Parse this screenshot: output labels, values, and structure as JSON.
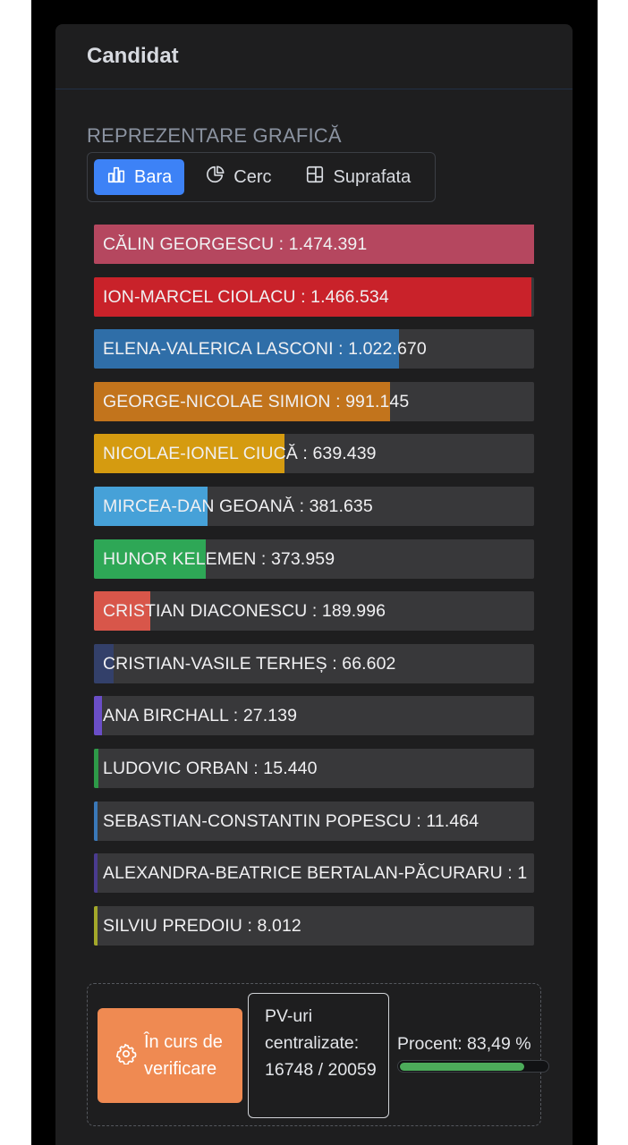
{
  "header": {
    "title": "Candidat"
  },
  "chart_section": {
    "label": "REPREZENTARE GRAFICĂ"
  },
  "view_toggle": {
    "options": [
      {
        "label": "Bara",
        "icon": "bar-chart-icon",
        "active": true
      },
      {
        "label": "Cerc",
        "icon": "pie-chart-icon",
        "active": false
      },
      {
        "label": "Suprafata",
        "icon": "area-grid-icon",
        "active": false
      }
    ],
    "accent": "#3d82f6"
  },
  "chart_data": {
    "type": "bar",
    "orientation": "horizontal",
    "categories": [
      "CĂLIN GEORGESCU",
      "ION-MARCEL CIOLACU",
      "ELENA-VALERICA LASCONI",
      "GEORGE-NICOLAE SIMION",
      "NICOLAE-IONEL CIUCĂ",
      "MIRCEA-DAN GEOANĂ",
      "HUNOR KELEMEN",
      "CRISTIAN DIACONESCU",
      "CRISTIAN-VASILE TERHEȘ",
      "ANA BIRCHALL",
      "LUDOVIC ORBAN",
      "SEBASTIAN-CONSTANTIN POPESCU",
      "ALEXANDRA-BEATRICE BERTALAN-PĂCURARU",
      "SILVIU PREDOIU"
    ],
    "values": [
      1474391,
      1466534,
      1022670,
      991145,
      639439,
      381635,
      373959,
      189996,
      66602,
      27139,
      15440,
      11464,
      10000,
      8012
    ],
    "labels": [
      "CĂLIN GEORGESCU : 1.474.391",
      "ION-MARCEL CIOLACU : 1.466.534",
      "ELENA-VALERICA LASCONI : 1.022.670",
      "GEORGE-NICOLAE SIMION : 991.145",
      "NICOLAE-IONEL CIUCĂ : 639.439",
      "MIRCEA-DAN GEOANĂ : 381.635",
      "HUNOR KELEMEN : 373.959",
      "CRISTIAN DIACONESCU : 189.996",
      "CRISTIAN-VASILE TERHEȘ : 66.602",
      "ANA BIRCHALL : 27.139",
      "LUDOVIC ORBAN : 15.440",
      "SEBASTIAN-CONSTANTIN POPESCU : 11.464",
      "ALEXANDRA-BEATRICE BERTALAN-PĂCURARU : 1",
      "SILVIU PREDOIU : 8.012"
    ],
    "colors": [
      "#b5475f",
      "#c9222a",
      "#2f6ea8",
      "#c2741c",
      "#d59b10",
      "#46a1d8",
      "#2ea756",
      "#d8564a",
      "#33406a",
      "#6a4ec7",
      "#2e9a48",
      "#3a78b8",
      "#4a3b8f",
      "#a3a82a"
    ],
    "track_color": "#38383a",
    "xlim": [
      0,
      1474391
    ]
  },
  "status": {
    "verify_label": "În curs de verificare",
    "verify_color": "#ef8a52",
    "pv_text": "PV-uri centralizate: 16748 / 20059",
    "percent_label": "Procent: 83,49 %",
    "percent_value": 83.49,
    "percent_color": "#4cab5a"
  }
}
